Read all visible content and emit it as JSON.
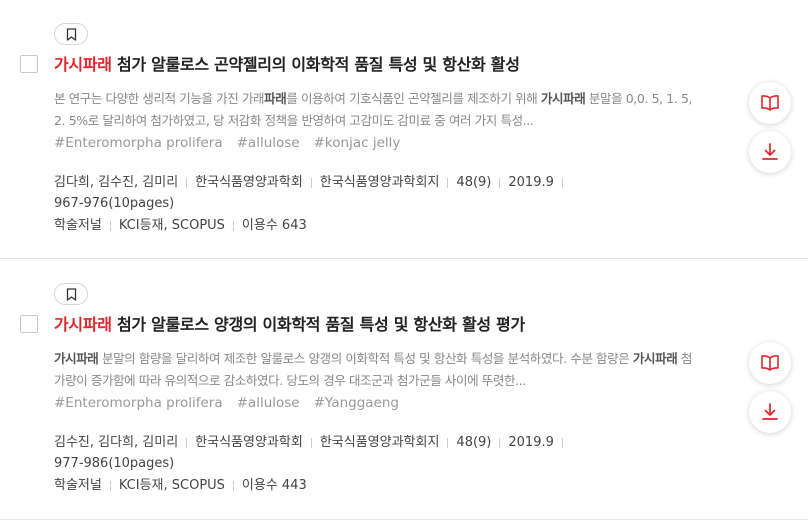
{
  "results": [
    {
      "title_highlight": "가시파래",
      "title_rest": " 첨가 알룰로스 곤약젤리의 이화학적 품질 특성 및 항산화 활성",
      "abstract_parts": [
        {
          "t": "본 연구는 다양한 생리적 기능을 가진 가래"
        },
        {
          "t": "파래",
          "hl": true
        },
        {
          "t": "를 이용하여 기호식품인 곤약젤리를 제조하기 위해 "
        },
        {
          "t": "가시파래",
          "hl": true
        },
        {
          "t": " 분말을 0,0. 5, 1. 5, 2. 5%로 달리하여 첨가하였고, 당 저감화 정책을 반영하여 고감미도 감미료 중 여러 가지 특성..."
        }
      ],
      "keywords": [
        "#Enteromorpha prolifera",
        "#allulose",
        "#konjac jelly"
      ],
      "authors": "김다희, 김수진, 김미리",
      "publisher": "한국식품영양과학회",
      "journal": "한국식품영양과학회지",
      "volume": "48(9)",
      "date": "2019.9",
      "pages": "967-976(10pages)",
      "type": "학술저널",
      "index": "KCI등재, SCOPUS",
      "usage": "이용수 643"
    },
    {
      "title_highlight": "가시파래",
      "title_rest": " 첨가 알룰로스 양갱의 이화학적 품질 특성 및 항산화 활성 평가",
      "abstract_parts": [
        {
          "t": "가시파래",
          "hl": true
        },
        {
          "t": " 분말의 함량을 달리하여 제조한 알룰로스 양갱의 이화학적 특성 및 항산화 특성을 분석하였다. 수분 함량은 "
        },
        {
          "t": "가시파래",
          "hl": true
        },
        {
          "t": " 첨가량이 증가함에 따라 유의적으로 감소하였다. 당도의 경우 대조군과 첨가군들 사이에 뚜렷한..."
        }
      ],
      "keywords": [
        "#Enteromorpha prolifera",
        "#allulose",
        "#Yanggaeng"
      ],
      "authors": "김수진, 김다희, 김미리",
      "publisher": "한국식품영양과학회",
      "journal": "한국식품영양과학회지",
      "volume": "48(9)",
      "date": "2019.9",
      "pages": "977-986(10pages)",
      "type": "학술저널",
      "index": "KCI등재, SCOPUS",
      "usage": "이용수 443"
    }
  ],
  "icons": {
    "bookmark": "bookmark-icon",
    "read": "book-open-icon",
    "download": "download-icon"
  },
  "colors": {
    "accent": "#e0262b",
    "text": "#222222",
    "muted": "#888888"
  }
}
